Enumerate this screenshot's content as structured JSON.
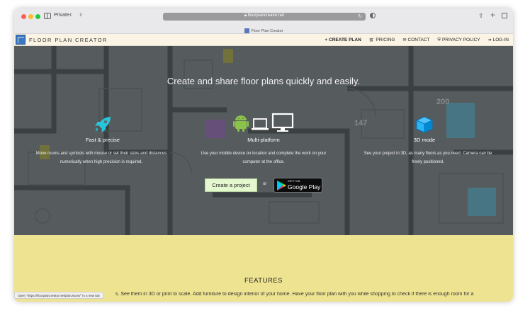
{
  "browser": {
    "private_label": "Private",
    "url": "floorplancreator.net",
    "tab_title": "Floor Plan Creator",
    "status_tip": "Open “https://floorplancreator.net/planJsons/” in a new tab"
  },
  "header": {
    "site_name": "FLOOR PLAN CREATOR",
    "menu": [
      {
        "icon": "plus-icon",
        "glyph": "+",
        "label": "CREATE PLAN"
      },
      {
        "icon": "cart-icon",
        "glyph": "🛒",
        "label": "PRICING"
      },
      {
        "icon": "envelope-icon",
        "glyph": "✉",
        "label": "CONTACT"
      },
      {
        "icon": "shield-icon",
        "glyph": "⛨",
        "label": "PRIVACY POLICY"
      },
      {
        "icon": "login-icon",
        "glyph": "➜",
        "label": "LOG-IN"
      }
    ]
  },
  "hero": {
    "headline": "Create and share floor plans quickly and easily.",
    "features": [
      {
        "icon": "rocket-icon",
        "title": "Fast & precise",
        "desc_lines": [
          "Move rooms and symbols with mouse or set their sizes and distances",
          "numerically when high precision is required."
        ]
      },
      {
        "icon": "devices-icon",
        "title": "Multi-platform",
        "desc_lines": [
          "Use your mobile device on location and complete the work on your",
          "computer at the office."
        ]
      },
      {
        "icon": "cube-icon",
        "title": "3D mode",
        "desc_lines": [
          "See your project in 3D, as many floors as you need. Camera can be",
          "freely positioned."
        ]
      }
    ],
    "create_button": "Create a project",
    "or": "or",
    "play_small": "GET IT ON",
    "play_big": "Google Play",
    "plan_labels": [
      "147",
      "200"
    ]
  },
  "features": {
    "title": "FEATURES",
    "text": "s. See them in 3D or print to scale. Add furniture to design interior of your home. Have your floor plan with you while shopping to check if there is enough room for a"
  },
  "colors": {
    "accent_blue": "#3a78c2",
    "rocket": "#26c6da",
    "android": "#8bc34a",
    "cube": "#29b6f6",
    "features_bg": "#eee391",
    "header_bg": "#fbf3e4"
  }
}
